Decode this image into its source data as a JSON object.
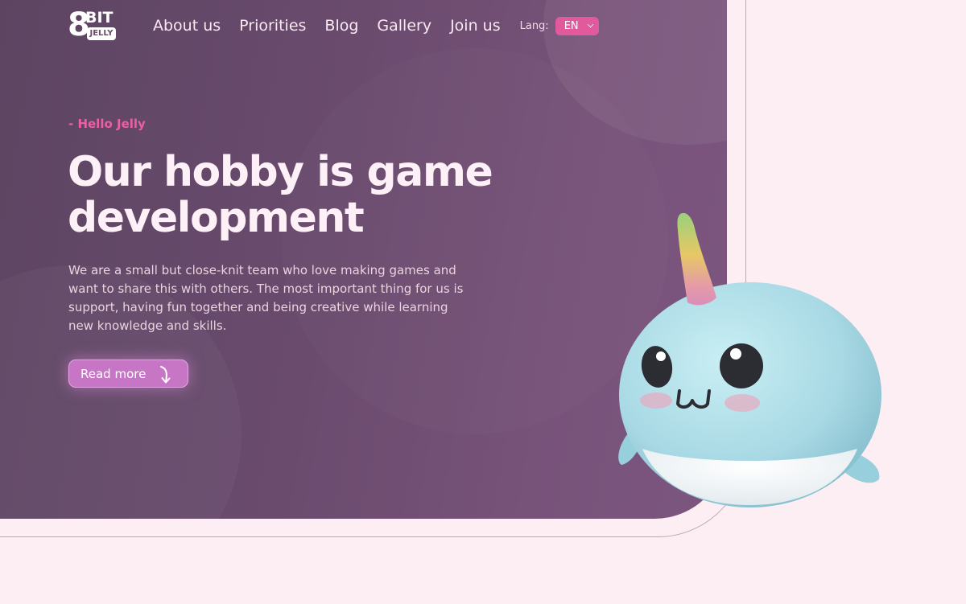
{
  "brand": {
    "logo_number": "8",
    "logo_word": "BIT",
    "logo_sub": "JELLY"
  },
  "nav": {
    "items": [
      {
        "label": "About us"
      },
      {
        "label": "Priorities"
      },
      {
        "label": "Blog"
      },
      {
        "label": "Gallery"
      },
      {
        "label": "Join us"
      }
    ],
    "lang_label": "Lang:",
    "lang_value": "EN"
  },
  "hero": {
    "eyebrow": "- Hello Jelly",
    "title": "Our hobby is game development",
    "body": "We are a small but close-knit team who love making games and want to share this with others. The most important thing for us is support, having fun together and being creative while learning new knowledge and skills.",
    "cta_label": "Read more"
  },
  "colors": {
    "page_bg": "#fdeef3",
    "hero_bg": "#6a4b6e",
    "accent_pink": "#e15a9d",
    "button": "#c776c5",
    "mascot_body": "#a9dbe6"
  },
  "icons": {
    "cta_icon": "arrow-down-curve-icon",
    "lang_icon": "chevron-down-icon",
    "mascot": "narwhal-mascot"
  }
}
